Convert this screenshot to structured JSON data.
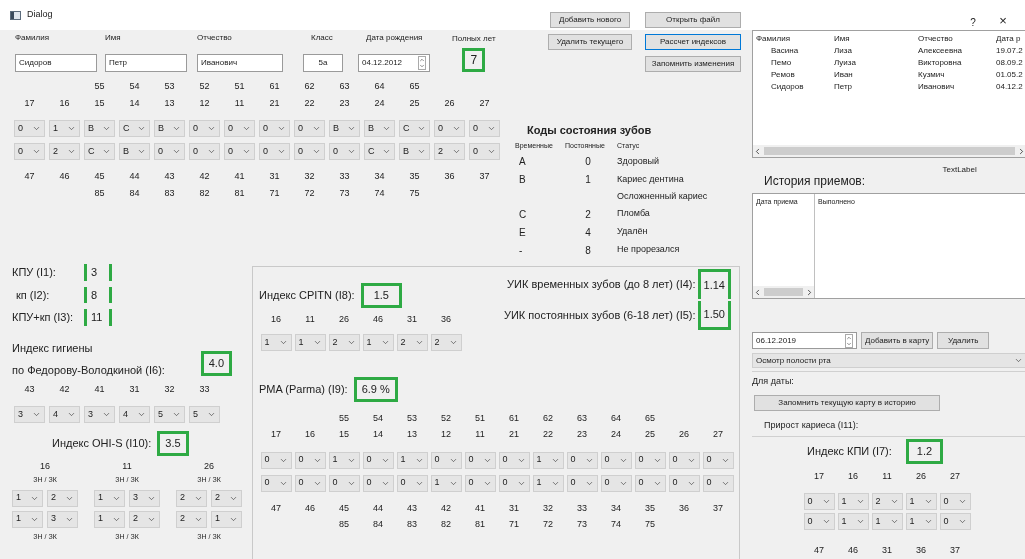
{
  "window": {
    "title": "Dialog",
    "help": "?",
    "close": "×"
  },
  "form": {
    "fields": [
      {
        "label": "Фамилия",
        "value": "Сидоров",
        "kind": "text"
      },
      {
        "label": "Имя",
        "value": "Петр",
        "kind": "text"
      },
      {
        "label": "Отчество",
        "value": "Иванович",
        "kind": "text"
      },
      {
        "label": "Класс",
        "value": "5а",
        "kind": "class"
      },
      {
        "label": "Дата рождения",
        "value": "04.12.2012",
        "kind": "date"
      }
    ],
    "age_label": "Полных лет",
    "age": "7"
  },
  "main_chart": {
    "upper_primary": [
      "55",
      "54",
      "53",
      "52",
      "51",
      "61",
      "62",
      "63",
      "64",
      "65"
    ],
    "upper_permanent": [
      "17",
      "16",
      "15",
      "14",
      "13",
      "12",
      "11",
      "21",
      "22",
      "23",
      "24",
      "25",
      "26",
      "27"
    ],
    "upper_codes": [
      "0",
      "1",
      "B",
      "C",
      "B",
      "0",
      "0",
      "0",
      "0",
      "B",
      "B",
      "C",
      "0",
      "0"
    ],
    "lower_codes": [
      "0",
      "2",
      "C",
      "B",
      "0",
      "0",
      "0",
      "0",
      "0",
      "0",
      "C",
      "B",
      "2",
      "0"
    ],
    "lower_permanent": [
      "47",
      "46",
      "45",
      "44",
      "43",
      "42",
      "41",
      "31",
      "32",
      "33",
      "34",
      "35",
      "36",
      "37"
    ],
    "lower_primary": [
      "85",
      "84",
      "83",
      "82",
      "81",
      "71",
      "72",
      "73",
      "74",
      "75"
    ]
  },
  "buttons": [
    {
      "label": "Добавить нового",
      "focused": false
    },
    {
      "label": "Открыть файл",
      "focused": false
    },
    {
      "label": "Удалить текущего",
      "focused": false
    },
    {
      "label": "Рассчет индексов",
      "focused": true
    },
    {
      "label": "Запомнить изменения",
      "focused": false
    }
  ],
  "legend": {
    "title": "Коды состояния зубов",
    "headers": [
      "Временные",
      "Постоянные",
      "Статус"
    ],
    "rows": [
      {
        "primary": "A",
        "permanent": "0",
        "status": "Здоровый"
      },
      {
        "primary": "B",
        "permanent": "1",
        "status": "Кариес дентина"
      },
      {
        "status": "Осложненный кариес"
      },
      {
        "primary": "C",
        "permanent": "2",
        "status": "Пломба"
      },
      {
        "primary": "E",
        "permanent": "4",
        "status": "Удалён"
      },
      {
        "primary": "-",
        "permanent": "8",
        "status": "Не прорезался"
      }
    ]
  },
  "patients": {
    "columns": [
      "Фамилия",
      "Имя",
      "Отчество",
      "Дата р"
    ],
    "rows": [
      [
        "Васина",
        "Лиза",
        "Алексеевна",
        "19.07.2"
      ],
      [
        "Пемо",
        "Луиза",
        "Викторовна",
        "08.09.2"
      ],
      [
        "Ремов",
        "Иван",
        "Кузмич",
        "01.05.2"
      ],
      [
        "Сидоров",
        "Петр",
        "Иванович",
        "04.12.2"
      ]
    ]
  },
  "text_label": "TextLabel",
  "history": {
    "title": "История приемов:",
    "columns": [
      "Дата приема",
      "Выполнено"
    ]
  },
  "visit": {
    "date": "06.12.2019",
    "add_button": "Добавить в карту",
    "delete_button": "Удалить",
    "procedure": "Осмотр полости рта",
    "for_date": "Для даты:",
    "save_button": "Запомнить текущую карту в историю",
    "increment_label": "Прирост кариеса (I11):"
  },
  "kpi": {
    "label": "Индекс КПИ (I7):",
    "value": "1.2",
    "upper": [
      "17",
      "16",
      "11",
      "26",
      "27"
    ],
    "codes": [
      [
        "0",
        "1",
        "2",
        "1",
        "0"
      ],
      [
        "0",
        "1",
        "1",
        "1",
        "0"
      ]
    ],
    "lower": [
      "47",
      "46",
      "31",
      "36",
      "37"
    ]
  },
  "kpu": [
    {
      "label": "КПУ (I1):",
      "value": "3"
    },
    {
      "label": "кп (I2):",
      "value": "8"
    },
    {
      "label": "КПУ+кп (I3):",
      "value": "11"
    }
  ],
  "hygiene": {
    "title": "Индекс гигиены",
    "label": "по Федорову-Володкиной (I6):",
    "value": "4.0",
    "teeth": [
      "43",
      "42",
      "41",
      "31",
      "32",
      "33"
    ],
    "codes": [
      "3",
      "4",
      "3",
      "4",
      "5",
      "5"
    ]
  },
  "ohis": {
    "label": "Индекс OHI-S (I10):",
    "value": "3.5",
    "groups": [
      {
        "tooth": "16",
        "header": "ЗН / ЗК",
        "rows": [
          [
            "1",
            "2"
          ],
          [
            "1",
            "3"
          ]
        ],
        "footer": "ЗН / ЗК"
      },
      {
        "tooth": "11",
        "header": "ЗН / ЗК",
        "rows": [
          [
            "1",
            "3"
          ],
          [
            "1",
            "2"
          ]
        ],
        "footer": "ЗН / ЗК"
      },
      {
        "tooth": "26",
        "header": "ЗН / ЗК",
        "rows": [
          [
            "2",
            "2"
          ],
          [
            "2",
            "1"
          ]
        ],
        "footer": "ЗН / ЗК"
      }
    ]
  },
  "cpitn": {
    "label": "Индекс CPITN (I8):",
    "value": "1.5",
    "teeth": [
      "16",
      "11",
      "26",
      "46",
      "31",
      "36"
    ],
    "codes": [
      "1",
      "1",
      "2",
      "1",
      "2",
      "2"
    ]
  },
  "uik": [
    {
      "label": "УИК временных зубов (до 8 лет) (I4):",
      "value": "1.14"
    },
    {
      "label": "УИК постоянных зубов (6-18 лет) (I5):",
      "value": "1.50"
    }
  ],
  "pma": {
    "label": "PMA (Parma) (I9):",
    "value": "6.9 %",
    "chart": {
      "upper_primary": [
        "55",
        "54",
        "53",
        "52",
        "51",
        "61",
        "62",
        "63",
        "64",
        "65"
      ],
      "upper_permanent": [
        "17",
        "16",
        "15",
        "14",
        "13",
        "12",
        "11",
        "21",
        "22",
        "23",
        "24",
        "25",
        "26",
        "27"
      ],
      "upper_codes": [
        "0",
        "0",
        "1",
        "0",
        "1",
        "0",
        "0",
        "0",
        "1",
        "0",
        "0",
        "0",
        "0",
        "0"
      ],
      "lower_codes": [
        "0",
        "0",
        "0",
        "0",
        "0",
        "1",
        "0",
        "0",
        "1",
        "0",
        "0",
        "0",
        "0",
        "0"
      ],
      "lower_permanent": [
        "47",
        "46",
        "45",
        "44",
        "43",
        "42",
        "41",
        "31",
        "32",
        "33",
        "34",
        "35",
        "36",
        "37"
      ],
      "lower_primary": [
        "85",
        "84",
        "83",
        "82",
        "81",
        "71",
        "72",
        "73",
        "74",
        "75"
      ]
    }
  }
}
